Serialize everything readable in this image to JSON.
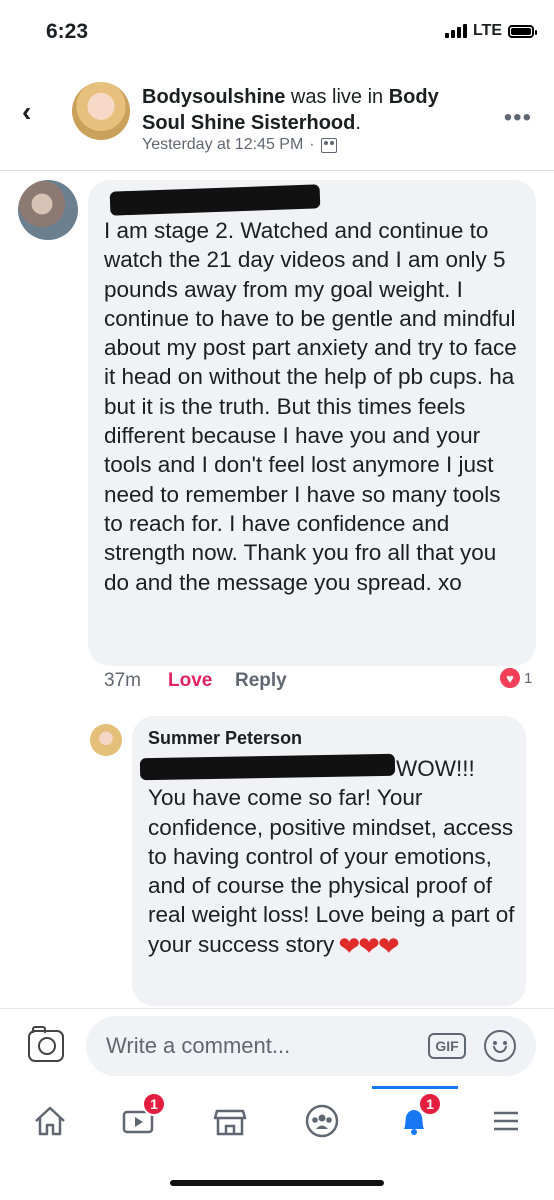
{
  "status_bar": {
    "time": "6:23",
    "network": "LTE"
  },
  "post": {
    "page_name": "Bodysoulshine",
    "action_text": " was live in ",
    "group_name": "Body Soul Shine Sisterhood",
    "timestamp": "Yesterday at 12:45 PM",
    "separator": "·"
  },
  "comments": [
    {
      "text": "I am stage 2.  Watched and continue to watch the 21 day videos and I am only 5 pounds away from my goal weight.  I continue to have to be gentle and mindful about my post part anxiety and try to face it head on without the help of pb cups.  ha but it is the truth.  But this times feels different because I have you and your tools and I don't feel lost anymore I just need to remember I have so many tools to reach for.  I have confidence and strength now.  Thank you fro all that you do and the message you spread.  xo",
      "time": "37m",
      "love_label": "Love",
      "reply_label": "Reply",
      "reaction_count": "1"
    },
    {
      "author": "Summer Peterson",
      "text_line1": "WOW!!!",
      "text": "You have come so far! Your confidence, positive mindset, access to having control of your emotions, and of course the physical proof of real weight loss! Love being a part of your success story",
      "hearts": "❤❤❤"
    }
  ],
  "composer": {
    "placeholder": "Write a comment...",
    "gif_label": "GIF"
  },
  "tabs": {
    "watch_badge": "1",
    "notifications_badge": "1"
  },
  "colors": {
    "accent": "#1877f2",
    "love": "#e0245e",
    "badge": "#e41e3f"
  }
}
